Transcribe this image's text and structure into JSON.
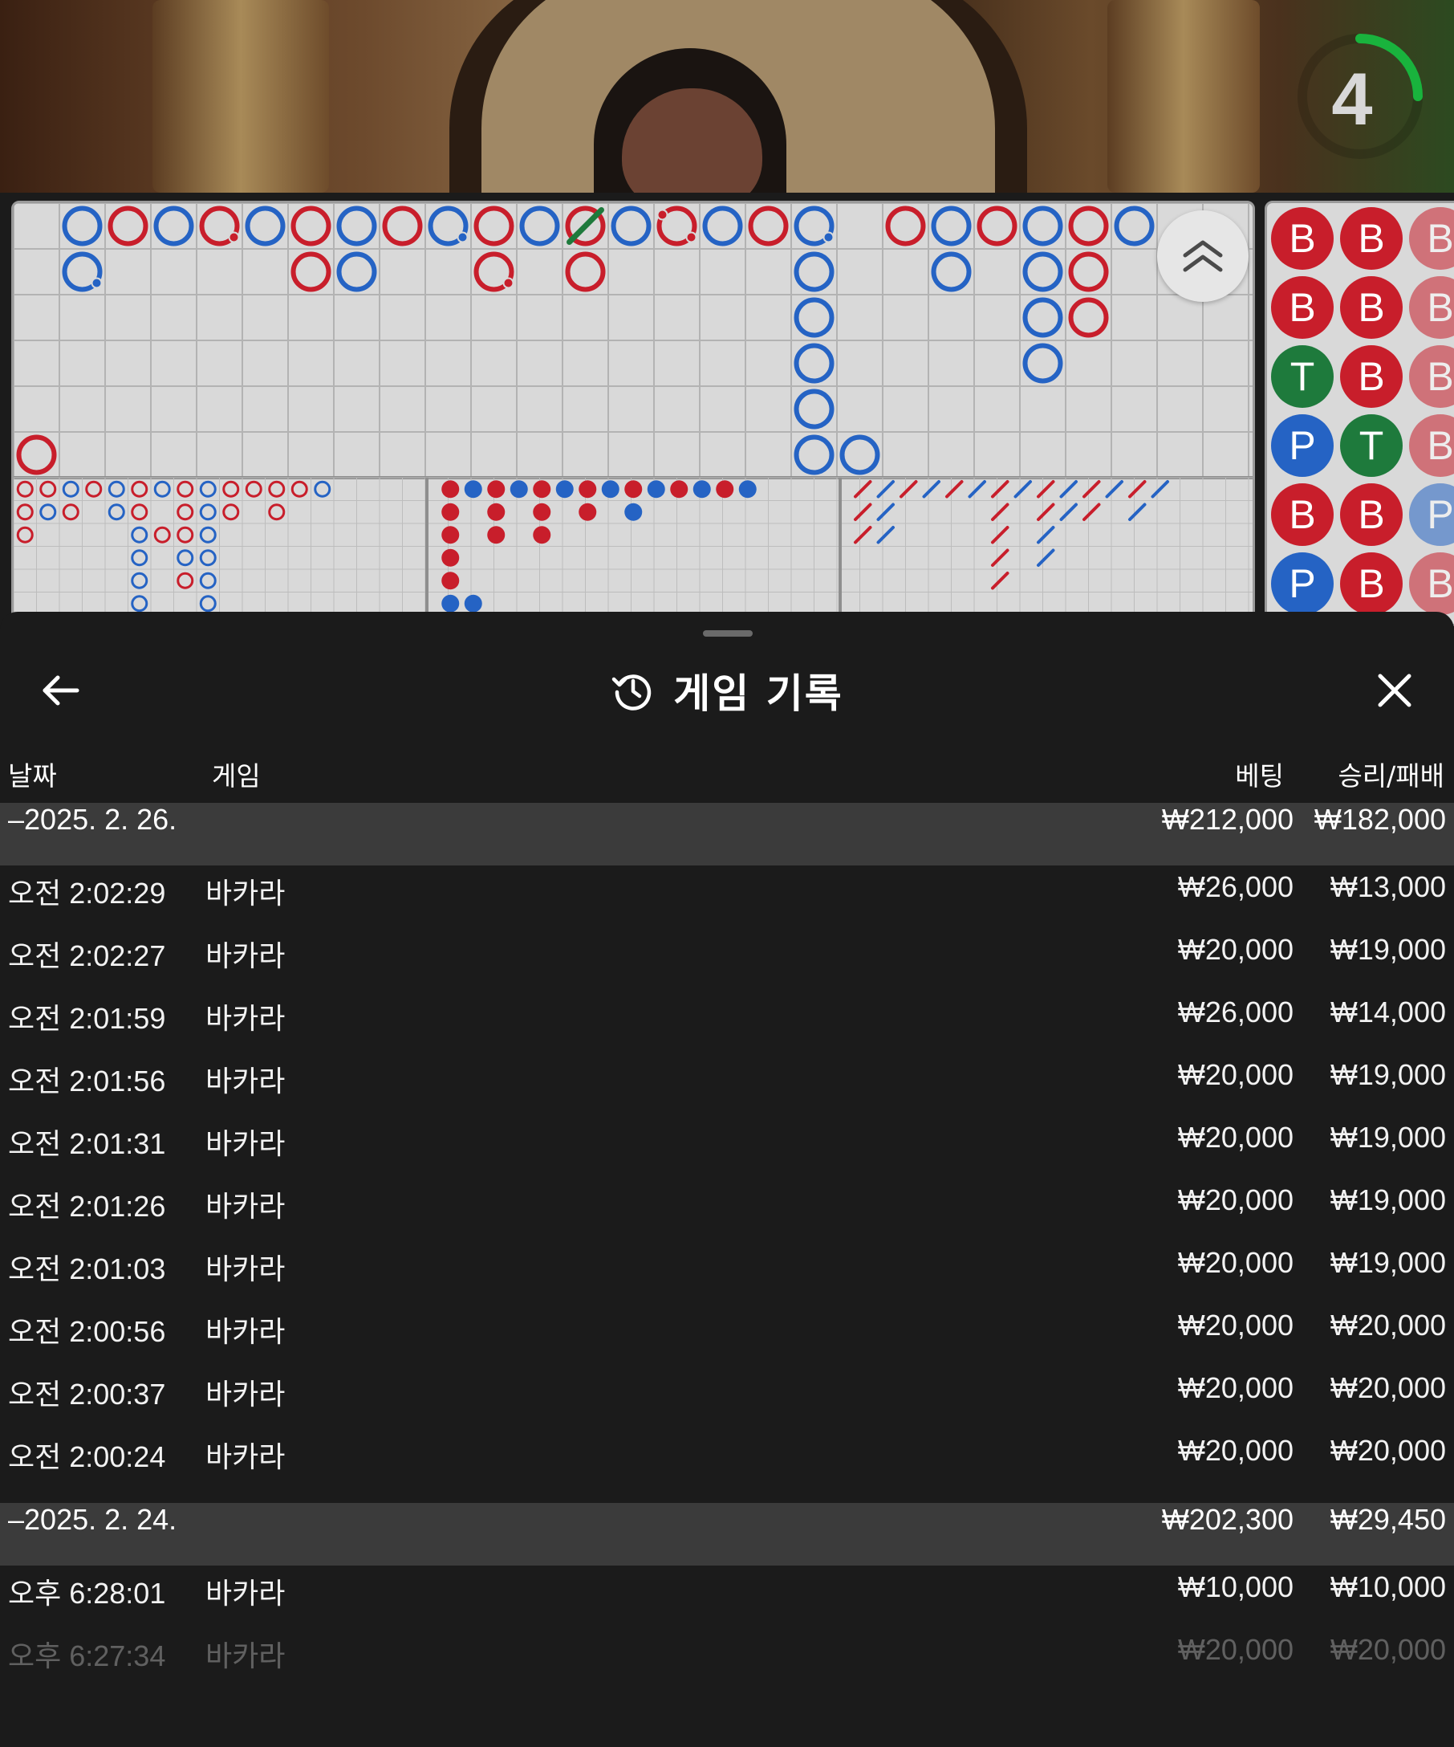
{
  "video": {
    "countdown": "4",
    "countdown_fraction": 0.25
  },
  "scoreboard": {
    "colors": {
      "red": "#c81e2b",
      "blue": "#2563c4",
      "green": "#1e7a3c"
    },
    "big_road": [
      {
        "c": "b",
        "r": 0,
        "s": "blue"
      },
      {
        "c": "b",
        "r": 1,
        "s": "blue",
        "mark": "dot"
      },
      {
        "c": "c",
        "r": 0,
        "s": "red"
      },
      {
        "c": "d",
        "r": 0,
        "s": "blue"
      },
      {
        "c": "e",
        "r": 0,
        "s": "red",
        "mark": "dot"
      },
      {
        "c": "f",
        "r": 0,
        "s": "blue"
      },
      {
        "c": "g",
        "r": 0,
        "s": "red"
      },
      {
        "c": "g",
        "r": 1,
        "s": "red"
      },
      {
        "c": "h",
        "r": 0,
        "s": "blue"
      },
      {
        "c": "h",
        "r": 1,
        "s": "blue"
      },
      {
        "c": "i",
        "r": 0,
        "s": "red"
      },
      {
        "c": "j",
        "r": 0,
        "s": "blue",
        "mark": "dot"
      },
      {
        "c": "k",
        "r": 0,
        "s": "red"
      },
      {
        "c": "k",
        "r": 1,
        "s": "red",
        "mark": "dot"
      },
      {
        "c": "l",
        "r": 0,
        "s": "blue"
      },
      {
        "c": "m",
        "r": 0,
        "s": "red",
        "mark": "tie"
      },
      {
        "c": "m",
        "r": 1,
        "s": "red"
      },
      {
        "c": "n",
        "r": 0,
        "s": "blue"
      },
      {
        "c": "o",
        "r": 0,
        "s": "red",
        "mark": "dot2"
      },
      {
        "c": "p",
        "r": 0,
        "s": "blue"
      },
      {
        "c": "q",
        "r": 0,
        "s": "red"
      },
      {
        "c": "r",
        "r": 0,
        "s": "blue",
        "mark": "dot"
      },
      {
        "c": "r",
        "r": 1,
        "s": "blue"
      },
      {
        "c": "r",
        "r": 2,
        "s": "blue"
      },
      {
        "c": "r",
        "r": 3,
        "s": "blue"
      },
      {
        "c": "r",
        "r": 4,
        "s": "blue"
      },
      {
        "c": "r",
        "r": 5,
        "s": "blue"
      },
      {
        "c": "s",
        "r": 5,
        "s": "blue"
      },
      {
        "c": "t",
        "r": 0,
        "s": "red"
      },
      {
        "c": "u",
        "r": 0,
        "s": "blue"
      },
      {
        "c": "u",
        "r": 1,
        "s": "blue"
      },
      {
        "c": "v",
        "r": 0,
        "s": "red"
      },
      {
        "c": "w",
        "r": 0,
        "s": "blue"
      },
      {
        "c": "w",
        "r": 1,
        "s": "blue"
      },
      {
        "c": "w",
        "r": 2,
        "s": "blue"
      },
      {
        "c": "w",
        "r": 3,
        "s": "blue"
      },
      {
        "c": "x",
        "r": 0,
        "s": "red"
      },
      {
        "c": "x",
        "r": 1,
        "s": "red"
      },
      {
        "c": "x",
        "r": 2,
        "s": "red"
      },
      {
        "c": "y",
        "r": 0,
        "s": "blue"
      },
      {
        "c": "a",
        "r": 5,
        "s": "red"
      }
    ],
    "bead_plate": [
      [
        "B",
        "B",
        "B"
      ],
      [
        "B",
        "B",
        "B"
      ],
      [
        "T",
        "B",
        "B"
      ],
      [
        "P",
        "T",
        "B"
      ],
      [
        "B",
        "B",
        "P"
      ],
      [
        "P",
        "B",
        "B"
      ]
    ]
  },
  "sheet": {
    "title": "게임 기록",
    "columns": {
      "date": "날짜",
      "game": "게임",
      "bet": "베팅",
      "win_loss": "승리/패배"
    },
    "groups": [
      {
        "date": "–2025. 2. 26.",
        "bet_total": "₩212,000",
        "win_total": "₩182,000",
        "rows": [
          {
            "time": "오전 2:02:29",
            "game": "바카라",
            "bet": "₩26,000",
            "win": "₩13,000"
          },
          {
            "time": "오전 2:02:27",
            "game": "바카라",
            "bet": "₩20,000",
            "win": "₩19,000"
          },
          {
            "time": "오전 2:01:59",
            "game": "바카라",
            "bet": "₩26,000",
            "win": "₩14,000"
          },
          {
            "time": "오전 2:01:56",
            "game": "바카라",
            "bet": "₩20,000",
            "win": "₩19,000"
          },
          {
            "time": "오전 2:01:31",
            "game": "바카라",
            "bet": "₩20,000",
            "win": "₩19,000"
          },
          {
            "time": "오전 2:01:26",
            "game": "바카라",
            "bet": "₩20,000",
            "win": "₩19,000"
          },
          {
            "time": "오전 2:01:03",
            "game": "바카라",
            "bet": "₩20,000",
            "win": "₩19,000"
          },
          {
            "time": "오전 2:00:56",
            "game": "바카라",
            "bet": "₩20,000",
            "win": "₩20,000"
          },
          {
            "time": "오전 2:00:37",
            "game": "바카라",
            "bet": "₩20,000",
            "win": "₩20,000"
          },
          {
            "time": "오전 2:00:24",
            "game": "바카라",
            "bet": "₩20,000",
            "win": "₩20,000"
          }
        ]
      },
      {
        "date": "–2025. 2. 24.",
        "bet_total": "₩202,300",
        "win_total": "₩29,450",
        "rows": [
          {
            "time": "오후 6:28:01",
            "game": "바카라",
            "bet": "₩10,000",
            "win": "₩10,000"
          },
          {
            "time": "오후 6:27:34",
            "game": "바카라",
            "bet": "₩20,000",
            "win": "₩20,000"
          }
        ]
      }
    ]
  }
}
